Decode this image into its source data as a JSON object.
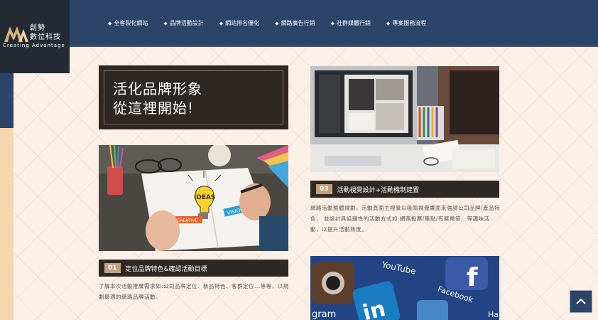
{
  "logo": {
    "cn_line1": "創勢",
    "cn_line2": "數位科技",
    "en": "Creating  Advantage"
  },
  "nav": [
    {
      "label": "全客製化網站"
    },
    {
      "label": "品牌活動設計"
    },
    {
      "label": "網站排名優化"
    },
    {
      "label": "網路廣告行銷"
    },
    {
      "label": "社群媒體行銷"
    },
    {
      "label": "專案服務流程"
    }
  ],
  "hero": {
    "line1": "活化品牌形象",
    "line2": "從這裡開始!"
  },
  "steps": [
    {
      "num": "01",
      "title": "定位品牌特色&確認活動目標",
      "desc": "了解本次活動推廣需求如:公司品牌定位、新品特色、客群定位...等等，以規劃最適的網路品牌活動。"
    },
    {
      "num": "03",
      "title": "活動視覺設計+活動機制建置",
      "desc": "網路活動整體規劃，活動頁面主視覺以吸睛視覺畫面來強調公司品牌/產品特色， 並設計具話題性的活動方式如:網路投票/集點/有獎徵答...等趣味活動，以提升活動熱度。"
    }
  ],
  "image_texts": {
    "ideas": "IDEAS",
    "vision": "VISION",
    "creative": "CREATIVE",
    "youtube": "YouTube",
    "facebook": "Facebook",
    "gram": "gram"
  },
  "colors": {
    "nav_bg": "#2b4467",
    "panel_dark": "#2e2825",
    "accent_tan": "#c3a27e",
    "page_bg": "#fcefe6"
  }
}
